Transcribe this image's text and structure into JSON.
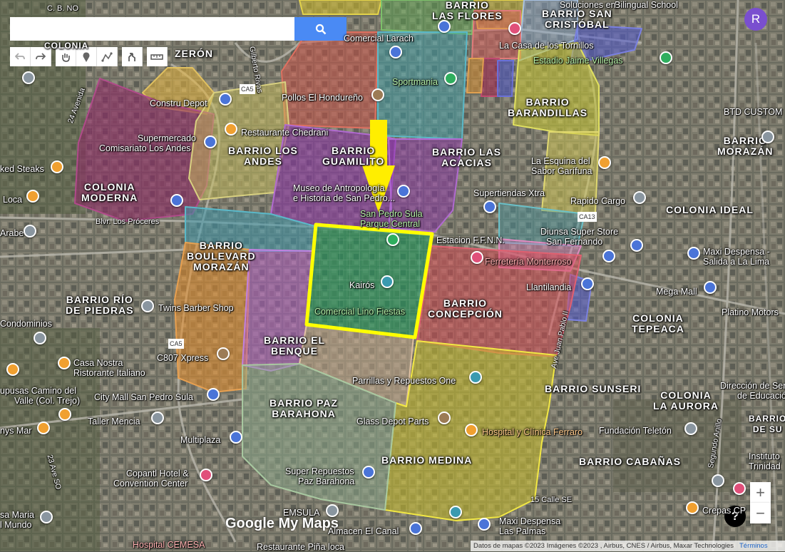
{
  "search": {
    "placeholder": "",
    "value": ""
  },
  "toolbar": {
    "icons": [
      "undo-icon",
      "redo-icon",
      "hand-icon",
      "add-marker-icon",
      "draw-line-icon",
      "directions-icon",
      "measure-icon"
    ]
  },
  "account": {
    "initial": "R"
  },
  "zoom": {
    "in": "+",
    "out": "−"
  },
  "help": {
    "label": "?"
  },
  "branding": {
    "google": "Google",
    "mymaps": "My Maps"
  },
  "attribution": {
    "text": "Datos de mapas ©2023 Imágenes ©2023 , Airbus, CNES / Airbus, Maxar Technologies",
    "link": "Términos"
  },
  "colors": {
    "highlight_border": "#ffff00",
    "arrow": "#ffee00",
    "search_button": "#4a8af4",
    "avatar": "#7a4fcf"
  },
  "neighborhoods": [
    {
      "id": "las-flores",
      "line1": "BARRIO",
      "line2": "LAS FLORES"
    },
    {
      "id": "san-cristobal",
      "line1": "BARRIO SAN",
      "line2": "CRISTÓBAL"
    },
    {
      "id": "zeron",
      "line1": "ZERÓN",
      "line2": ""
    },
    {
      "id": "barandillas",
      "line1": "BARRIO",
      "line2": "BARANDILLAS"
    },
    {
      "id": "los-andes",
      "line1": "BARRIO LOS",
      "line2": "ANDES"
    },
    {
      "id": "guamilito",
      "line1": "BARRIO",
      "line2": "GUAMILITO"
    },
    {
      "id": "las-acacias",
      "line1": "BARRIO LAS",
      "line2": "ACACIAS"
    },
    {
      "id": "morazan",
      "line1": "BARRIO",
      "line2": "MORAZÁN"
    },
    {
      "id": "colonia-moderna",
      "line1": "COLONIA",
      "line2": "MODERNA"
    },
    {
      "id": "colonia-ideal",
      "line1": "COLONIA IDEAL",
      "line2": ""
    },
    {
      "id": "boulevard-morazan",
      "line1": "BARRIO",
      "line2": "BOULEVARD",
      "line3": "MORAZÁN"
    },
    {
      "id": "rio-de-piedras",
      "line1": "BARRIO RÍO",
      "line2": "DE PIEDRAS"
    },
    {
      "id": "concepcion",
      "line1": "BARRIO",
      "line2": "CONCEPCIÓN"
    },
    {
      "id": "tepeaca",
      "line1": "COLONIA",
      "line2": "TEPEACA"
    },
    {
      "id": "el-benque",
      "line1": "BARRIO EL",
      "line2": "BENQUE"
    },
    {
      "id": "sunseri",
      "line1": "BARRIO SUNSERI",
      "line2": ""
    },
    {
      "id": "la-aurora",
      "line1": "COLONIA",
      "line2": "LA AURORA"
    },
    {
      "id": "paz-barahona",
      "line1": "BARRIO PAZ",
      "line2": "BARAHONA"
    },
    {
      "id": "medina",
      "line1": "BARRIO MEDINA",
      "line2": ""
    },
    {
      "id": "cabanas",
      "line1": "BARRIO CABAÑAS",
      "line2": ""
    }
  ],
  "places": {
    "bilingual": "Bilingual School",
    "soluciones": "Soluciones en",
    "bno": "C. B. NO",
    "colonia_top": "COLONIA",
    "larach": "Comercial Larach",
    "casa_tornillos": "La Casa de los Tornillos",
    "estadio": "Estadio Jaime Villegas",
    "construdepot": "Constru Depot",
    "pollos": "Pollos El Hondureño",
    "sportmania": "Sportmania",
    "btd": "BTD CUSTOM",
    "chedrani": "Restaurante Chedrani",
    "supermercado": "Supermercado",
    "comisariato": "Comisariato Los Andes",
    "steaks": "ked Steaks",
    "loca": "Loca",
    "museo1": "Museo de Antropología",
    "museo2": "e Historia de San Pedro...",
    "esquina1": "La Esquina del",
    "esquina2": "Sabor Garífuna",
    "xtra": "Supertiendas Xtra",
    "rapido": "Rapido Cargo",
    "parque1": "San Pedro Sula",
    "parque2": "Parque Central",
    "diunsa": "Diunsa Super Store",
    "sanfernando": "San Fernando",
    "estacion": "Estacion F.F.N.N.",
    "arabe": "Arabe",
    "proceres": "Blvr. Los Próceres",
    "maxi_lima1": "Maxi Despensa -",
    "maxi_lima2": "Salida a La Lima",
    "monterroso": "Ferretería Monterroso",
    "kairos": "Kairós",
    "llantilandia": "Llantilandia",
    "megamall": "Mega Mall",
    "platino": "Platino Motors",
    "lino": "Comercial Lino Fiestas",
    "twins": "Twins Barber Shop",
    "condominios": "Condominios",
    "c807": "C807 Xpress",
    "casa_nostra1": "Casa Nostra",
    "casa_nostra2": "Ristorante Italiano",
    "parrillas": "Parrillas y Repuestos One",
    "pupusas1": "upusas Camino del",
    "pupusas2": "Valle (Col. Trejo)",
    "citymall": "City Mall San Pedro Sula",
    "direccion1": "Dirección de Servicios",
    "direccion2": "de Educación",
    "taller": "Taller Mencia",
    "glass": "Glass Depot Parts",
    "nysmar": "nys Mar",
    "multiplaza": "Multiplaza",
    "ferraro": "Hospital y Clínica Ferraro",
    "teleton": "Fundación Teletón",
    "sanju1": "BARRIO",
    "sanju2": "DE SU",
    "copantl1": "Copantl Hotel &",
    "copantl2": "Convention Center",
    "superrep1": "Super Repuestos",
    "superrep2": "Paz Barahona",
    "instituto1": "Instituto",
    "instituto2": "Trinidad",
    "calle15": "15 Calle SE",
    "crepas": "Crepas CP",
    "emsula": "EMSULA",
    "maxi_palmas1": "Maxi Despensa",
    "maxi_palmas2": "Las Palmas",
    "almacen": "Almacen El Canal",
    "cemesa": "Hospital CEMESA",
    "pinaloca": "Restaurante Piña loca",
    "maria1": "sa Maria",
    "maria2": "l Mundo",
    "av24": "24 Avenida",
    "av23": "23 Ave SO",
    "rivas": "Gilberto Rivas",
    "ca5": "CA5",
    "ca13": "CA13",
    "juan_pablo": "Ave Juan Pablo II",
    "segundo_anillo": "Segundo Anillo"
  }
}
